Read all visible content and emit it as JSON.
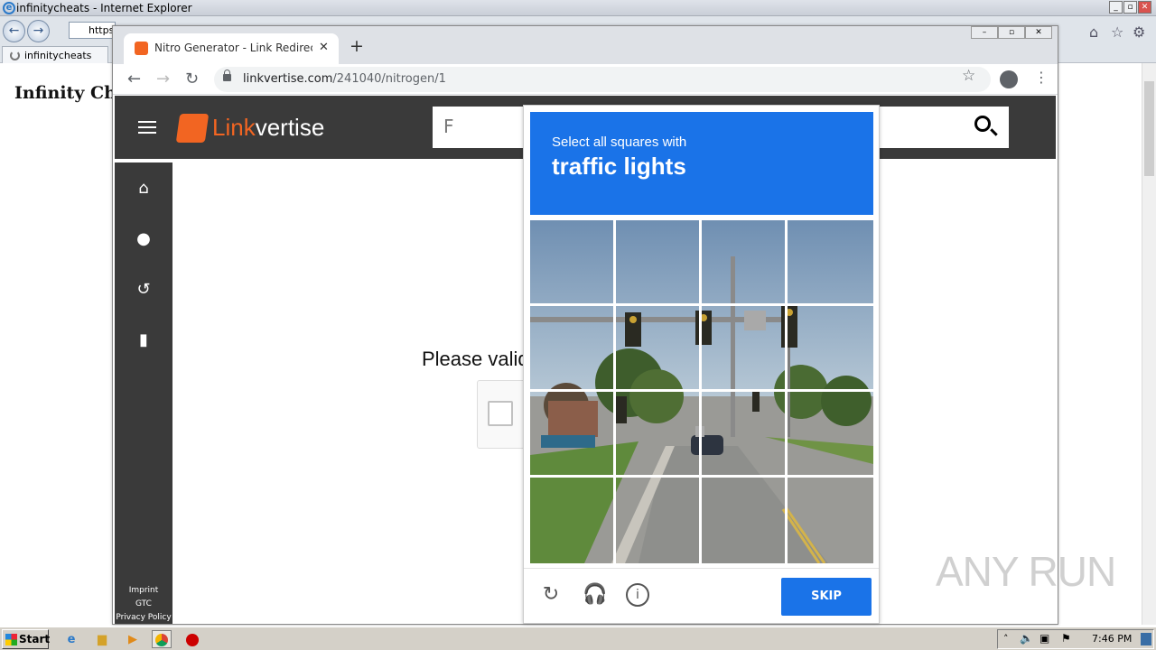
{
  "ie": {
    "window_title": "infinitycheats - Internet Explorer",
    "address_text": "https:",
    "tab_label": "infinitycheats",
    "page_heading": "Infinity Cheats",
    "min_label": "_",
    "max_label": "▫",
    "close_label": "✕"
  },
  "chrome": {
    "tab_title": "Nitro Generator - Link Redirect | Linkvertise",
    "tab_close": "✕",
    "new_tab": "+",
    "url_host": "linkvertise.com",
    "url_path": "/241040/nitrogen/1"
  },
  "linkvertise": {
    "logo_link": "Link",
    "logo_vertise": "vertise",
    "search_value": "F",
    "validate_text": "Please validate",
    "footer_links": [
      "Imprint",
      "GTC",
      "Privacy Policy"
    ]
  },
  "captcha": {
    "instruction": "Select all squares with",
    "target": "traffic lights",
    "skip_label": "SKIP"
  },
  "watermark": "ANY RUN",
  "taskbar": {
    "start_label": "Start",
    "clock": "7:46 PM"
  },
  "colors": {
    "captcha_blue": "#1a73e8",
    "linkvertise_orange": "#f26522",
    "linkvertise_dark": "#3a3a3a"
  }
}
